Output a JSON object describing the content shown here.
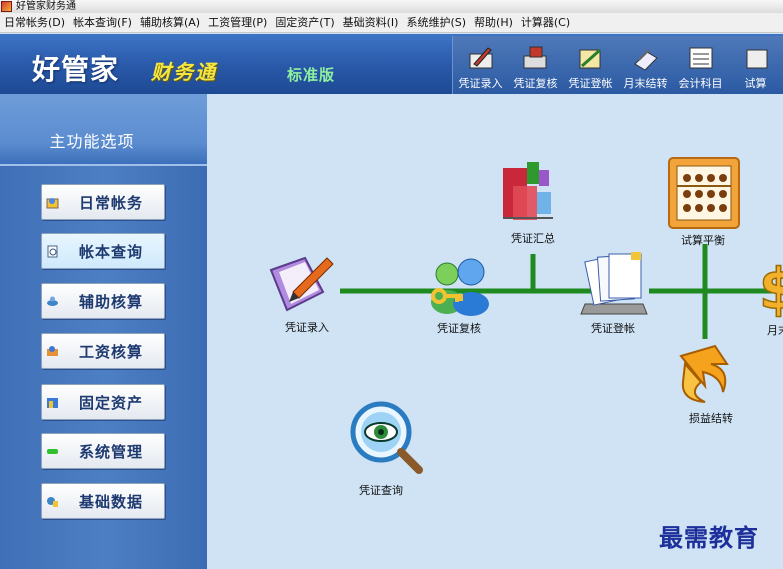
{
  "window": {
    "title": "好管家财务通"
  },
  "menubar": {
    "items": [
      "日常帐务(D)",
      "帐本查询(F)",
      "辅助核算(A)",
      "工资管理(P)",
      "固定资产(T)",
      "基础资料(I)",
      "系统维护(S)",
      "帮助(H)",
      "计算器(C)"
    ]
  },
  "header": {
    "brand": "好管家",
    "sub_brand": "财务通",
    "edition": "标准版"
  },
  "toolbar": {
    "items": [
      {
        "label": "凭证录入",
        "icon": "voucher-entry-icon"
      },
      {
        "label": "凭证复核",
        "icon": "voucher-review-icon"
      },
      {
        "label": "凭证登帐",
        "icon": "voucher-post-icon"
      },
      {
        "label": "月末结转",
        "icon": "month-end-icon"
      },
      {
        "label": "会计科目",
        "icon": "accounts-icon"
      },
      {
        "label": "试算",
        "icon": "trial-balance-icon"
      }
    ]
  },
  "sidebar": {
    "title": "主功能选项",
    "items": [
      {
        "label": "日常帐务",
        "icon": "daily-icon",
        "active": false
      },
      {
        "label": "帐本查询",
        "icon": "ledger-query-icon",
        "active": true
      },
      {
        "label": "辅助核算",
        "icon": "auxiliary-icon",
        "active": false
      },
      {
        "label": "工资核算",
        "icon": "payroll-icon",
        "active": false
      },
      {
        "label": "固定资产",
        "icon": "fixed-assets-icon",
        "active": false
      },
      {
        "label": "系统管理",
        "icon": "system-icon",
        "active": false
      },
      {
        "label": "基础数据",
        "icon": "basic-data-icon",
        "active": false
      }
    ]
  },
  "flow": {
    "voucher_entry": "凭证录入",
    "voucher_review": "凭证复核",
    "voucher_summary": "凭证汇总",
    "voucher_post": "凭证登帐",
    "trial_balance": "试算平衡",
    "month_end": "月末",
    "profit_loss": "损益结转",
    "voucher_query": "凭证查询"
  },
  "watermark": "最需教育",
  "colors": {
    "flow_line": "#1f8a1f",
    "header_blue": "#2958a8",
    "main_bg": "#cfe3f5"
  }
}
